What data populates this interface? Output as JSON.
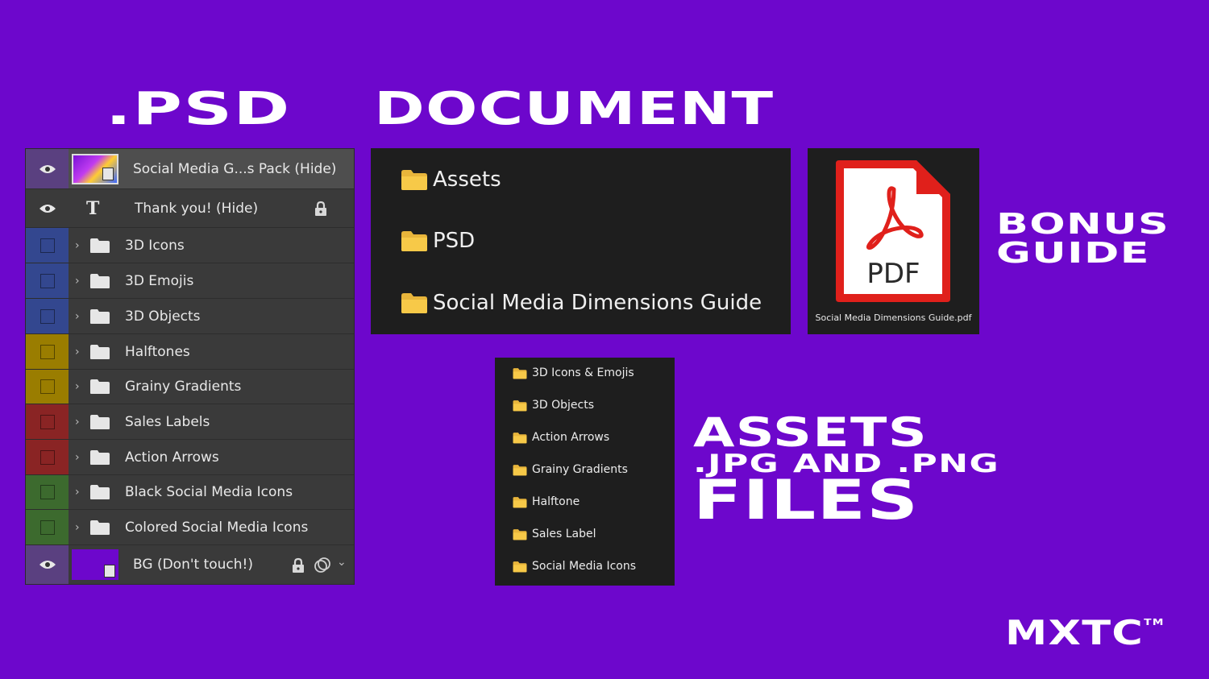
{
  "headings": {
    "psd": ".PSD",
    "document": "DOCUMENT",
    "bonus_line1": "BONUS",
    "bonus_line2": "GUIDE",
    "assets_line1": "ASSETS",
    "assets_line2": ".JPG AND .PNG",
    "assets_line3": "FILES",
    "brand": "MXTC",
    "brand_tm": "TM"
  },
  "layers": [
    {
      "name": "Social Media G...s Pack (Hide)",
      "kind": "smart-object",
      "visible": true,
      "color": "#5a4080",
      "locked": false
    },
    {
      "name": "Thank you! (Hide)",
      "kind": "text",
      "visible": true,
      "color": "#3a3a3a",
      "locked": true
    },
    {
      "name": "3D Icons",
      "kind": "group",
      "visible": false,
      "color": "#33478f"
    },
    {
      "name": "3D Emojis",
      "kind": "group",
      "visible": false,
      "color": "#33478f"
    },
    {
      "name": "3D Objects",
      "kind": "group",
      "visible": false,
      "color": "#33478f"
    },
    {
      "name": "Halftones",
      "kind": "group",
      "visible": false,
      "color": "#9a7d00"
    },
    {
      "name": "Grainy Gradients",
      "kind": "group",
      "visible": false,
      "color": "#9a7d00"
    },
    {
      "name": "Sales Labels",
      "kind": "group",
      "visible": false,
      "color": "#8a2424"
    },
    {
      "name": "Action Arrows",
      "kind": "group",
      "visible": false,
      "color": "#8a2424"
    },
    {
      "name": "Black Social Media Icons",
      "kind": "group",
      "visible": false,
      "color": "#3c6a2e"
    },
    {
      "name": "Colored Social Media Icons",
      "kind": "group",
      "visible": false,
      "color": "#3c6a2e"
    },
    {
      "name": "BG (Don't touch!)",
      "kind": "smart-object",
      "visible": true,
      "color": "#5a4080",
      "locked": true
    }
  ],
  "explorer": {
    "items": [
      "Assets",
      "PSD",
      "Social Media Dimensions Guide"
    ]
  },
  "pdf": {
    "icon_label": "PDF",
    "filename": "Social Media Dimensions Guide.pdf"
  },
  "assets_list": {
    "items": [
      "3D Icons & Emojis",
      "3D Objects",
      "Action Arrows",
      "Grainy Gradients",
      "Halftone",
      "Sales Label",
      "Social Media Icons"
    ]
  },
  "colors": {
    "background": "#6d07cc",
    "folder": "#f7c948",
    "pdf_red": "#e0201b"
  }
}
